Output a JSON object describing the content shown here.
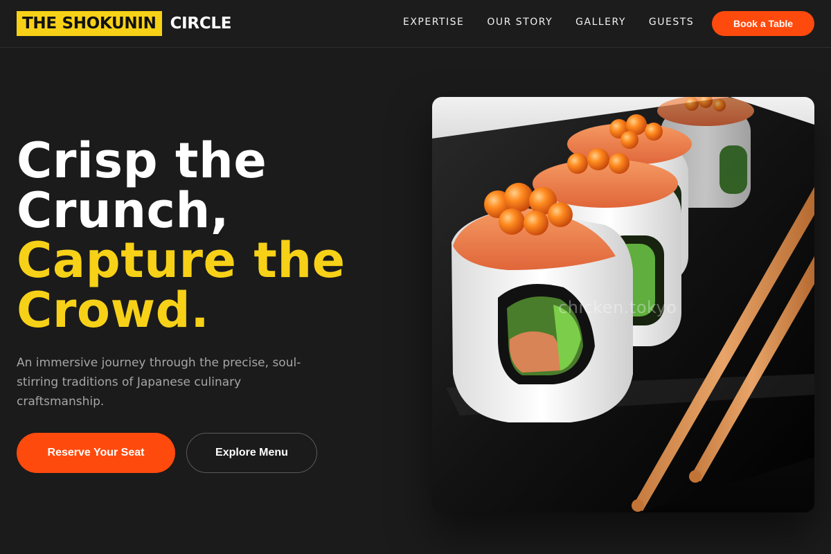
{
  "nav": {
    "logo_highlight": "THE SHOKUNIN",
    "logo_rest": "CIRCLE",
    "items": [
      {
        "label": "EXPERTISE"
      },
      {
        "label": "OUR STORY"
      },
      {
        "label": "GALLERY"
      },
      {
        "label": "GUESTS"
      }
    ],
    "cta": "Book a Table"
  },
  "hero": {
    "title_line1": "Crisp the",
    "title_line2": "Crunch,",
    "title_line3": "Capture the",
    "title_line4": "Crowd.",
    "subtitle": "An immersive journey through the precise, soul-stirring traditions of Japanese culinary craftsmanship.",
    "primary_button": "Reserve Your Seat",
    "secondary_button": "Explore Menu",
    "image_watermark": "chicken.tokyo"
  },
  "colors": {
    "background": "#1b1b1b",
    "accent_yellow": "#f7d117",
    "accent_orange": "#ff4a0d"
  }
}
